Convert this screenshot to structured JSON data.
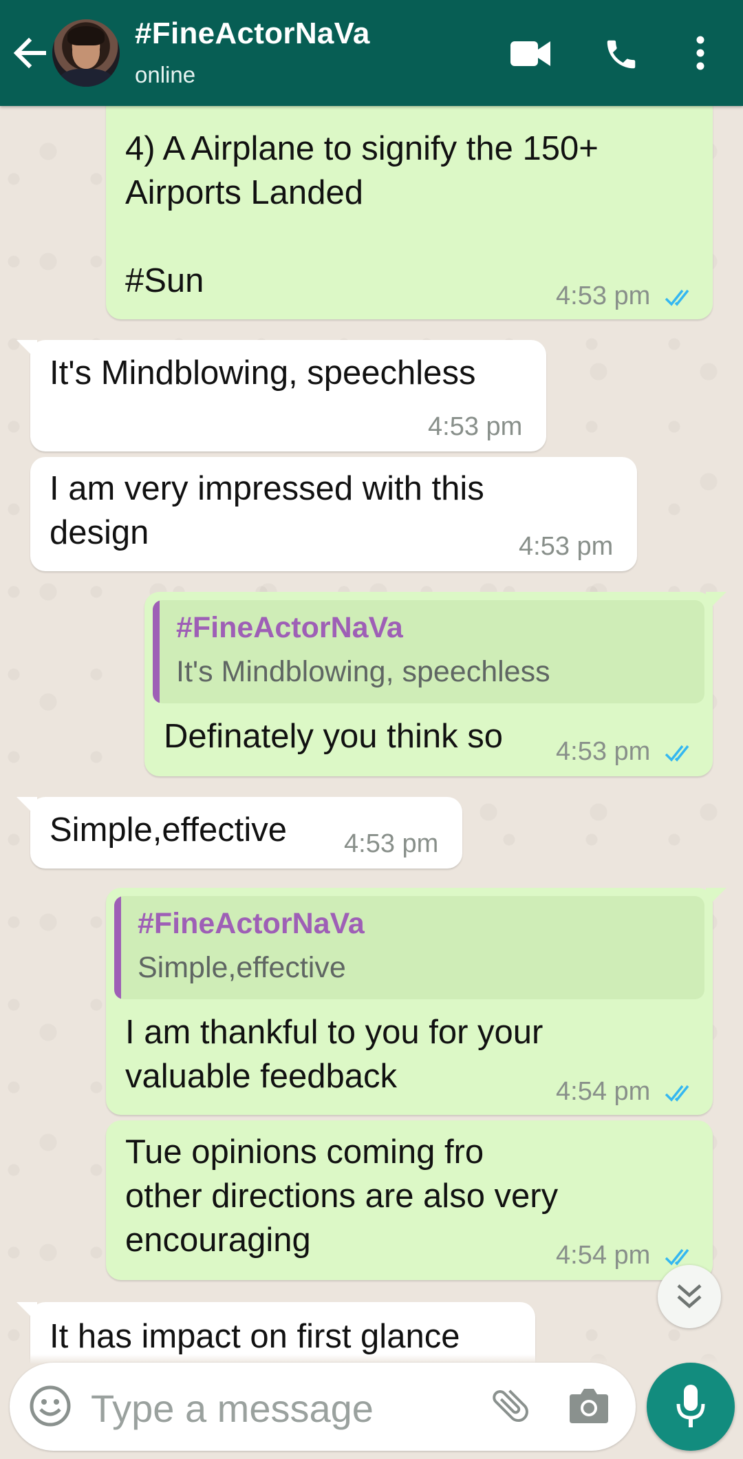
{
  "header": {
    "contact_name": "#FineActorNaVa",
    "status": "online",
    "icons": [
      "back-arrow-icon",
      "video-call-icon",
      "voice-call-icon",
      "more-options-icon"
    ]
  },
  "messages": [
    {
      "dir": "out",
      "text": "4) A Airplane to signify the 150+\nAirports Landed\n\n#Sun",
      "time": "4:53 pm",
      "read": true
    },
    {
      "dir": "in",
      "text": "It's Mindblowing, speechless",
      "time": "4:53 pm"
    },
    {
      "dir": "in",
      "text": "I am very impressed with this\ndesign",
      "time": "4:53 pm"
    },
    {
      "dir": "out",
      "quote": {
        "author": "#FineActorNaVa",
        "text": "It's Mindblowing, speechless"
      },
      "text": "Definately you think so",
      "time": "4:53 pm",
      "read": true
    },
    {
      "dir": "in",
      "text": "Simple,effective",
      "time": "4:53 pm"
    },
    {
      "dir": "out",
      "quote": {
        "author": "#FineActorNaVa",
        "text": "Simple,effective"
      },
      "text": "I am thankful to you for your\nvaluable feedback",
      "time": "4:54 pm",
      "read": true
    },
    {
      "dir": "out",
      "text": "Tue opinions coming fro\nother directions are also very\nencouraging",
      "time": "4:54 pm",
      "read": true
    },
    {
      "dir": "in",
      "text": "It has impact on first glance"
    }
  ],
  "composer": {
    "placeholder": "Type a message",
    "icons": [
      "emoji-icon",
      "attach-icon",
      "camera-icon",
      "mic-icon"
    ]
  },
  "colors": {
    "header": "#075e54",
    "outgoing_bubble": "#dcf8c6",
    "incoming_bubble": "#ffffff",
    "read_ticks": "#34b7f1",
    "quote_author": "#9e5fb6",
    "mic_button": "#128c7e"
  }
}
